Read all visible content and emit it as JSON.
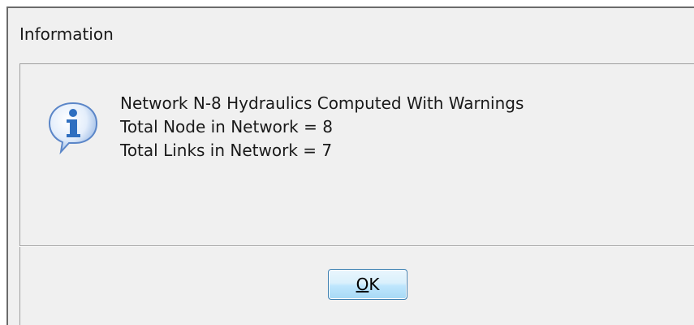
{
  "dialog": {
    "title": "Information",
    "icon": "information-icon",
    "messages": [
      "Network N-8 Hydraulics Computed With Warnings",
      "Total Node in Network = 8",
      "Total Links in Network = 7"
    ],
    "ok_button": {
      "mnemonic": "O",
      "rest": "K"
    }
  },
  "colors": {
    "window_bg": "#f0f0f0",
    "button_border": "#3c7fb1",
    "icon_blue": "#2f6fc0"
  }
}
